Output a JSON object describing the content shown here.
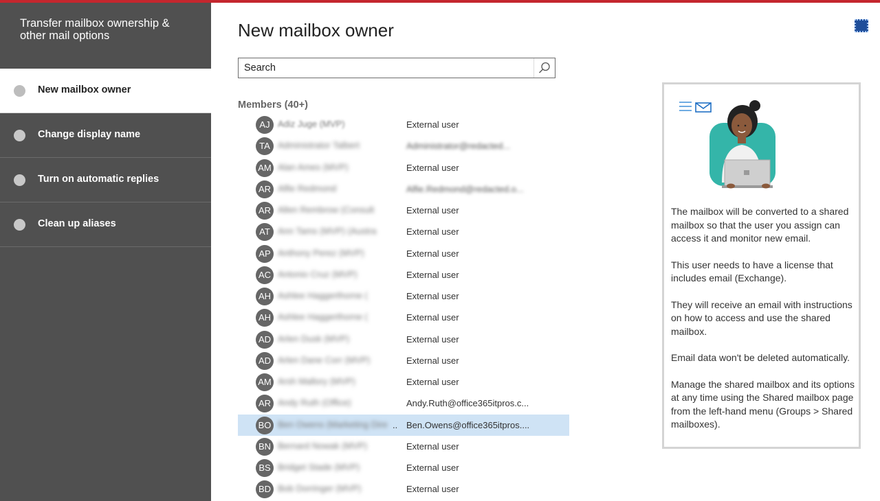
{
  "sidebar": {
    "title": "Transfer mailbox ownership & other mail options",
    "steps": [
      {
        "label": "New mailbox owner",
        "active": true
      },
      {
        "label": "Change display name",
        "active": false
      },
      {
        "label": "Turn on automatic replies",
        "active": false
      },
      {
        "label": "Clean up aliases",
        "active": false
      }
    ]
  },
  "main": {
    "title": "New mailbox owner",
    "search": {
      "placeholder": "Search"
    },
    "members_header": "Members (40+)"
  },
  "members": [
    {
      "initials": "AJ",
      "name": "Adiz Juge (MVP)",
      "email": "External user",
      "email_blurred": false,
      "selected": false
    },
    {
      "initials": "TA",
      "name": "Administrator Talbert",
      "email": "Administrator@redacted...",
      "email_blurred": true,
      "selected": false
    },
    {
      "initials": "AM",
      "name": "Alan Ames (MVP)",
      "email": "External user",
      "email_blurred": false,
      "selected": false
    },
    {
      "initials": "AR",
      "name": "Alfie Redmond",
      "email": "Alfie.Redmond@redacted.o...",
      "email_blurred": true,
      "selected": false
    },
    {
      "initials": "AR",
      "name": "Allen Rembrow (Consult",
      "email": "External user",
      "email_blurred": false,
      "selected": false
    },
    {
      "initials": "AT",
      "name": "Ann Tams (MVP) (Austra",
      "email": "External user",
      "email_blurred": false,
      "selected": false
    },
    {
      "initials": "AP",
      "name": "Anthony Perez (MVP)",
      "email": "External user",
      "email_blurred": false,
      "selected": false
    },
    {
      "initials": "AC",
      "name": "Antonio Cruz (MVP)",
      "email": "External user",
      "email_blurred": false,
      "selected": false
    },
    {
      "initials": "AH",
      "name": "Ashlee Haggerthorne (",
      "email": "External user",
      "email_blurred": false,
      "selected": false
    },
    {
      "initials": "AH",
      "name": "Ashlee Haggerthorne (",
      "email": "External user",
      "email_blurred": false,
      "selected": false
    },
    {
      "initials": "AD",
      "name": "Arlen Dusk (MVP)",
      "email": "External user",
      "email_blurred": false,
      "selected": false
    },
    {
      "initials": "AD",
      "name": "Arlen Dane Corr (MVP)",
      "email": "External user",
      "email_blurred": false,
      "selected": false
    },
    {
      "initials": "AM",
      "name": "Arsh Mallory (MVP)",
      "email": "External user",
      "email_blurred": false,
      "selected": false
    },
    {
      "initials": "AR",
      "name": "Andy Ruth (Office)",
      "email": "Andy.Ruth@office365itpros.c...",
      "email_blurred": false,
      "selected": false
    },
    {
      "initials": "BO",
      "name": "Ben Owens (Marketing Dire",
      "email": "Ben.Owens@office365itpros....",
      "email_blurred": false,
      "selected": true
    },
    {
      "initials": "BN",
      "name": "Bernard Nowak (MVP)",
      "email": "External user",
      "email_blurred": false,
      "selected": false
    },
    {
      "initials": "BS",
      "name": "Bridget Stade (MVP)",
      "email": "External user",
      "email_blurred": false,
      "selected": false
    },
    {
      "initials": "BD",
      "name": "Bob Dorringer (MVP)",
      "email": "External user",
      "email_blurred": false,
      "selected": false
    }
  ],
  "info_panel": {
    "paragraphs": [
      "The mailbox will be converted to a shared mailbox so that the user you assign can access it and monitor new email.",
      "This user needs to have a license that includes email (Exchange).",
      "They will receive an email with instructions on how to access and use the shared mailbox.",
      "Email data won't be deleted automatically.",
      "Manage the shared mailbox and its options at any time using the Shared mailbox page from the left-hand menu (Groups > Shared mailboxes)."
    ]
  },
  "icons": {
    "search": "search-icon",
    "corner": "app-launcher-icon",
    "illustration": "person-with-laptop-illustration"
  },
  "colors": {
    "accent_bar": "#c4262e",
    "sidebar_bg": "#505050",
    "selected_row": "#cfe3f5",
    "avatar_bg": "#666666"
  }
}
